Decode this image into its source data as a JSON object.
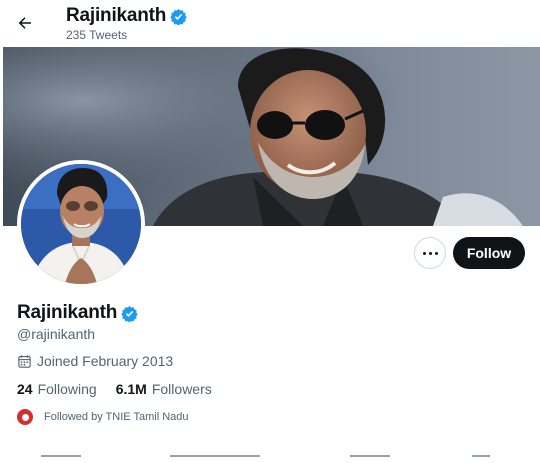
{
  "header": {
    "name": "Rajinikanth",
    "tweet_count": "235 Tweets"
  },
  "profile": {
    "name": "Rajinikanth",
    "handle": "@rajinikanth",
    "joined": "Joined February 2013",
    "following_count": "24",
    "following_label": "Following",
    "followers_count": "6.1M",
    "followers_label": "Followers",
    "followed_by": "Followed by TNIE Tamil Nadu"
  },
  "actions": {
    "follow_label": "Follow"
  },
  "colors": {
    "verified": "#1d9bf0",
    "follow_button": "#0f1419",
    "secondary_text": "#536471"
  }
}
